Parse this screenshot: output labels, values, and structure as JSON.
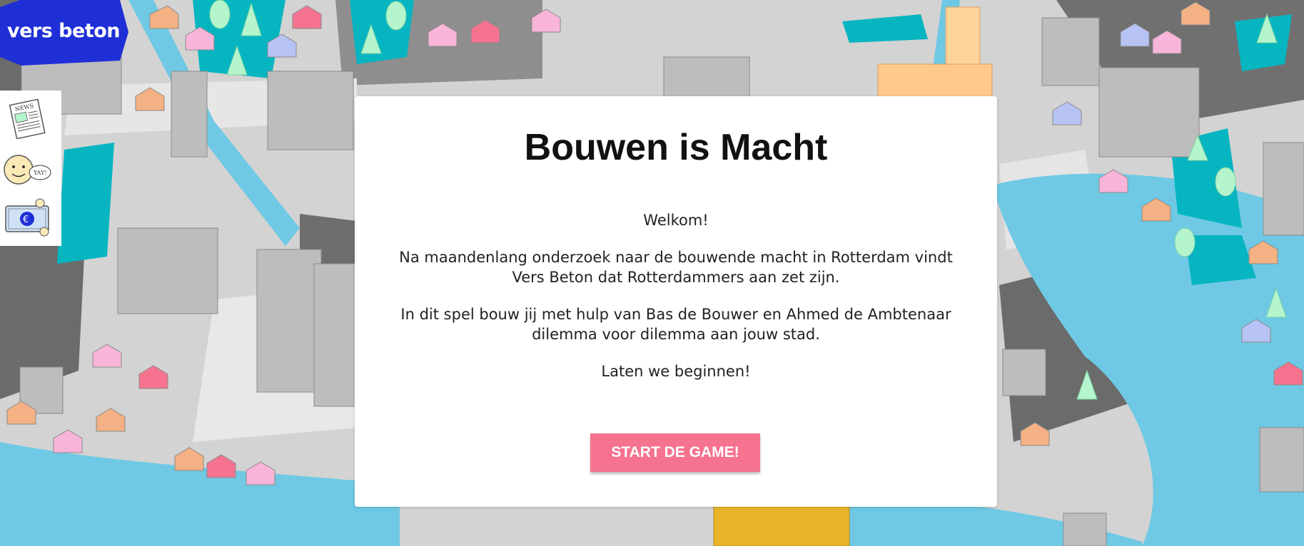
{
  "logo": {
    "text": "vers beton",
    "color": "#1f2fd6"
  },
  "side_icons": [
    {
      "name": "newspaper-icon",
      "label": "NEWS"
    },
    {
      "name": "smiley-face-icon",
      "label": "YAY!"
    },
    {
      "name": "money-bill-icon",
      "label": "€"
    }
  ],
  "intro": {
    "title": "Bouwen is Macht",
    "paragraphs": [
      "Welkom!",
      "Na maandenlang onderzoek naar de bouwende macht in Rotterdam vindt Vers Beton dat Rotterdammers aan zet zijn.",
      "In dit spel bouw jij met hulp van Bas de Bouwer en Ahmed de Ambtenaar dilemma voor dilemma aan jouw stad.",
      "Laten we beginnen!"
    ],
    "start_button": "START DE GAME!"
  },
  "colors": {
    "water": "#6fc9e4",
    "teal": "#07b5c1",
    "accent_pink": "#f5738f",
    "logo_blue": "#1f2fd6"
  }
}
